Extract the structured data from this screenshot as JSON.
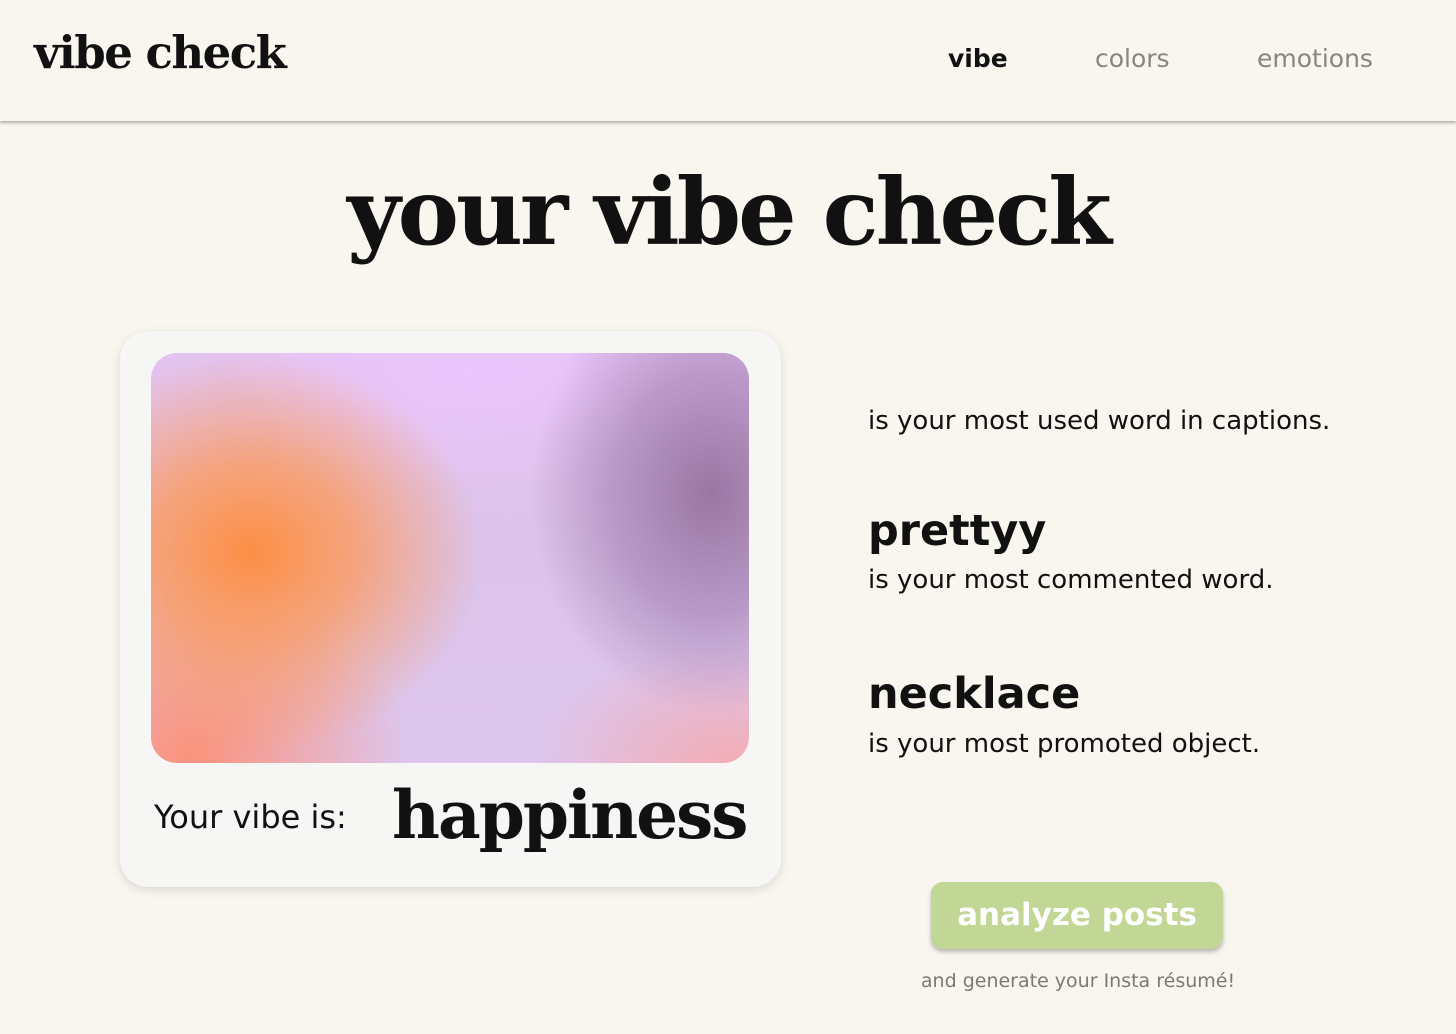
{
  "header": {
    "logo": "vibe check",
    "nav": [
      {
        "label": "vibe",
        "active": true
      },
      {
        "label": "colors",
        "active": false
      },
      {
        "label": "emotions",
        "active": false
      }
    ]
  },
  "hero": {
    "title": "your vibe check"
  },
  "vibe_card": {
    "label": "Your vibe is:",
    "vibe": "happiness"
  },
  "stats": [
    {
      "word": "",
      "description": "is your most used word in captions."
    },
    {
      "word": "prettyy",
      "description": "is your most commented word."
    },
    {
      "word": "necklace",
      "description": "is your most promoted object."
    }
  ],
  "action": {
    "button_label": "analyze posts",
    "subtext": "and generate your Insta résumé!"
  },
  "colors": {
    "background": "#f9f5ef",
    "card": "#f6f6f5",
    "button": "#c2d695",
    "text": "#111111",
    "muted": "#8a8580"
  }
}
